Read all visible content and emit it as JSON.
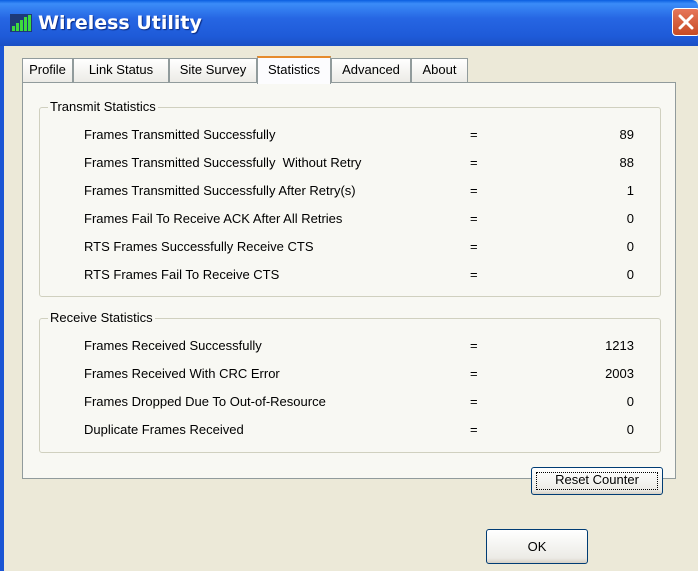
{
  "window": {
    "title": "Wireless Utility",
    "icons": {
      "app": "signal-bars-icon",
      "close": "close-icon"
    }
  },
  "tabs": [
    {
      "label": "Profile",
      "active": false
    },
    {
      "label": "Link Status",
      "active": false
    },
    {
      "label": "Site Survey",
      "active": false
    },
    {
      "label": "Statistics",
      "active": true
    },
    {
      "label": "Advanced",
      "active": false
    },
    {
      "label": "About",
      "active": false
    }
  ],
  "transmit": {
    "title": "Transmit Statistics",
    "rows": [
      {
        "label": "Frames Transmitted Successfully",
        "eq": "=",
        "value": "89"
      },
      {
        "label": "Frames Transmitted Successfully  Without Retry",
        "eq": "=",
        "value": "88"
      },
      {
        "label": "Frames Transmitted Successfully After Retry(s)",
        "eq": "=",
        "value": "1"
      },
      {
        "label": "Frames Fail To Receive ACK After All Retries",
        "eq": "=",
        "value": "0"
      },
      {
        "label": "RTS Frames Successfully Receive CTS",
        "eq": "=",
        "value": "0"
      },
      {
        "label": "RTS Frames Fail To Receive CTS",
        "eq": "=",
        "value": "0"
      }
    ]
  },
  "receive": {
    "title": "Receive Statistics",
    "rows": [
      {
        "label": "Frames Received Successfully",
        "eq": "=",
        "value": "1213"
      },
      {
        "label": "Frames Received With CRC Error",
        "eq": "=",
        "value": "2003"
      },
      {
        "label": "Frames Dropped Due To Out-of-Resource",
        "eq": "=",
        "value": "0"
      },
      {
        "label": "Duplicate Frames Received",
        "eq": "=",
        "value": "0"
      }
    ]
  },
  "buttons": {
    "reset": "Reset Counter",
    "ok": "OK"
  },
  "colors": {
    "titlebar": "#2666E3",
    "active_tab_accent": "#E68B2C",
    "close_button": "#C74B24"
  }
}
